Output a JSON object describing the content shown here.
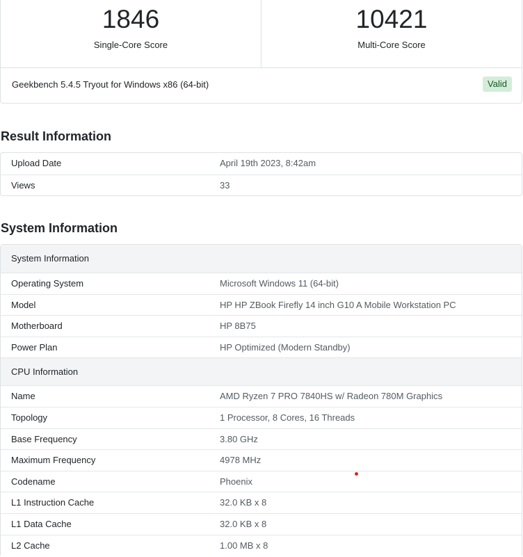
{
  "scores": {
    "single_core": {
      "value": "1846",
      "label": "Single-Core Score"
    },
    "multi_core": {
      "value": "10421",
      "label": "Multi-Core Score"
    }
  },
  "version": {
    "text": "Geekbench 5.4.5 Tryout for Windows x86 (64-bit)",
    "status": "Valid"
  },
  "result_info": {
    "title": "Result Information",
    "rows": [
      {
        "key": "Upload Date",
        "value": "April 19th 2023, 8:42am"
      },
      {
        "key": "Views",
        "value": "33"
      }
    ]
  },
  "system_info": {
    "title": "System Information",
    "groups": [
      {
        "header": "System Information",
        "rows": [
          {
            "key": "Operating System",
            "value": "Microsoft Windows 11 (64-bit)"
          },
          {
            "key": "Model",
            "value": "HP HP ZBook Firefly 14 inch G10 A Mobile Workstation PC"
          },
          {
            "key": "Motherboard",
            "value": "HP 8B75"
          },
          {
            "key": "Power Plan",
            "value": "HP Optimized (Modern Standby)"
          }
        ]
      },
      {
        "header": "CPU Information",
        "rows": [
          {
            "key": "Name",
            "value": "AMD Ryzen 7 PRO 7840HS w/ Radeon 780M Graphics"
          },
          {
            "key": "Topology",
            "value": "1 Processor, 8 Cores, 16 Threads"
          },
          {
            "key": "Base Frequency",
            "value": "3.80 GHz"
          },
          {
            "key": "Maximum Frequency",
            "value": "4978 MHz"
          },
          {
            "key": "Codename",
            "value": "Phoenix"
          },
          {
            "key": "L1 Instruction Cache",
            "value": "32.0 KB x 8"
          },
          {
            "key": "L1 Data Cache",
            "value": "32.0 KB x 8"
          },
          {
            "key": "L2 Cache",
            "value": "1.00 MB x 8"
          }
        ]
      }
    ]
  },
  "colors": {
    "valid_bg": "#d4edda",
    "valid_text": "#155724",
    "group_header_bg": "#f3f4f5",
    "border": "#dee2e6"
  }
}
